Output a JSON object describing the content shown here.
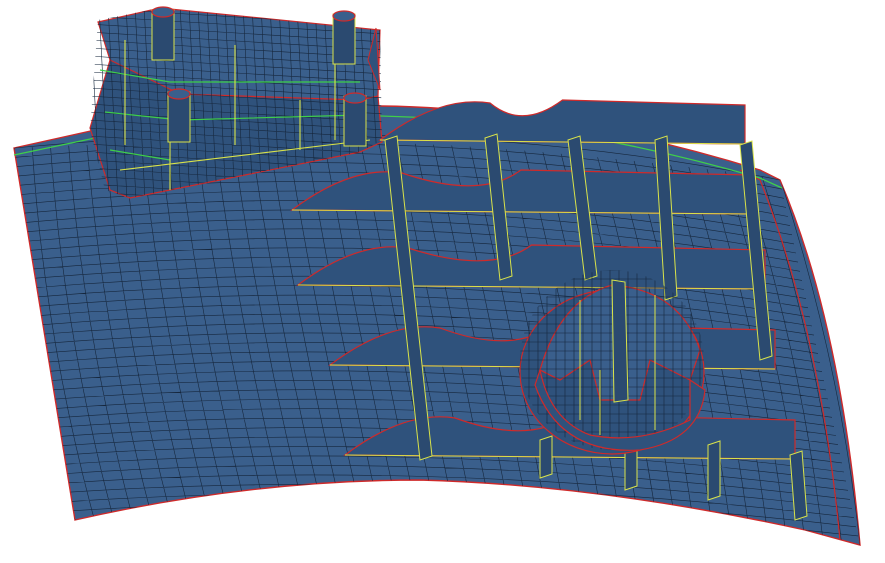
{
  "scene": {
    "background": "#ffffff",
    "colors": {
      "surface": "#3a5f8c",
      "surface_dark": "#2b4a70",
      "surface_side": "#2f527c",
      "mesh_line": "#16273d",
      "feature_edge": "#d9e34a",
      "free_edge": "#cf2a2a",
      "green_edge": "#3fcf4a"
    },
    "components": [
      {
        "name": "curved-base-plate"
      },
      {
        "name": "raised-boss-block"
      },
      {
        "name": "rib-grid"
      },
      {
        "name": "circular-boss"
      }
    ]
  }
}
